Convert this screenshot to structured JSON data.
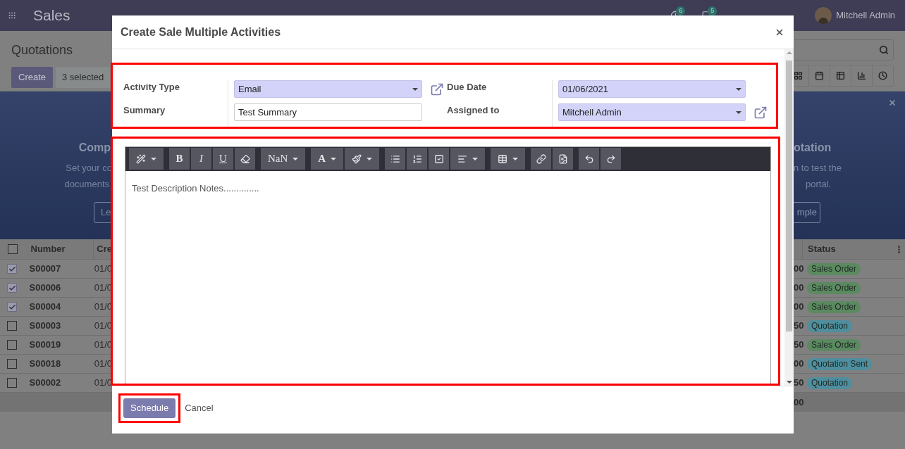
{
  "navbar": {
    "app": "Sales",
    "activity_count": "6",
    "message_count": "5",
    "user": "Mitchell Admin"
  },
  "control_panel": {
    "title": "Quotations",
    "create": "Create",
    "selection": "3 selected"
  },
  "banner": {
    "left_title": "Comp",
    "left_lines": [
      "Set your co",
      "documents"
    ],
    "left_button": "Le",
    "right_title": "otation",
    "right_lines": [
      "n to test the",
      "portal."
    ],
    "right_button": "mple"
  },
  "table": {
    "all_checked": false,
    "columns": [
      "Number",
      "Cre",
      "Status"
    ],
    "rows": [
      {
        "checked": true,
        "number": "S00007",
        "created": "01/0",
        "amount": "00",
        "status": "Sales Order",
        "color": "#5b8a60"
      },
      {
        "checked": true,
        "number": "S00006",
        "created": "01/0",
        "amount": "00",
        "status": "Sales Order",
        "color": "#5b8a60"
      },
      {
        "checked": true,
        "number": "S00004",
        "created": "01/0",
        "amount": "00",
        "status": "Sales Order",
        "color": "#5b8a60"
      },
      {
        "checked": false,
        "number": "S00003",
        "created": "01/0",
        "amount": "50",
        "status": "Quotation",
        "color": "#4e8e9e"
      },
      {
        "checked": false,
        "number": "S00019",
        "created": "01/0",
        "amount": "50",
        "status": "Sales Order",
        "color": "#5b8a60"
      },
      {
        "checked": false,
        "number": "S00018",
        "created": "01/0",
        "amount": "00",
        "status": "Quotation Sent",
        "color": "#4e8e9e"
      },
      {
        "checked": false,
        "number": "S00002",
        "created": "01/0",
        "amount": "50",
        "status": "Quotation",
        "color": "#4e8e9e"
      }
    ],
    "total": "00"
  },
  "dialog": {
    "title": "Create Sale Multiple Activities",
    "left_fields": [
      {
        "label": "Activity Type",
        "value": "Email",
        "kind": "select",
        "link": true
      },
      {
        "label": "Summary",
        "value": "Test Summary",
        "kind": "text",
        "link": false
      }
    ],
    "right_fields": [
      {
        "label": "Due Date",
        "value": "01/06/2021",
        "kind": "select",
        "link": false
      },
      {
        "label": "Assigned to",
        "value": "Mitchell Admin",
        "kind": "select",
        "link": true
      }
    ],
    "toolbar": [
      [
        {
          "kind": "icon",
          "dropdown": true
        }
      ],
      [
        {
          "kind": "text",
          "label": "B",
          "dropdown": false
        },
        {
          "kind": "text",
          "label": "I",
          "dropdown": false
        },
        {
          "kind": "text",
          "label": "U",
          "dropdown": false
        },
        {
          "kind": "icon",
          "dropdown": false
        }
      ],
      [
        {
          "kind": "text",
          "label": "NaN",
          "dropdown": true
        }
      ],
      [
        {
          "kind": "text",
          "label": "A",
          "dropdown": true
        },
        {
          "kind": "icon",
          "dropdown": true
        }
      ],
      [
        {
          "kind": "icon",
          "dropdown": false
        },
        {
          "kind": "icon",
          "dropdown": false
        },
        {
          "kind": "icon",
          "dropdown": false
        },
        {
          "kind": "icon",
          "dropdown": true
        }
      ],
      [
        {
          "kind": "icon",
          "dropdown": true
        }
      ],
      [
        {
          "kind": "icon",
          "dropdown": false
        },
        {
          "kind": "icon",
          "dropdown": false
        }
      ],
      [
        {
          "kind": "icon",
          "dropdown": false
        },
        {
          "kind": "icon",
          "dropdown": false
        }
      ]
    ],
    "notes": "Test Description Notes..............",
    "schedule": "Schedule",
    "cancel": "Cancel"
  }
}
